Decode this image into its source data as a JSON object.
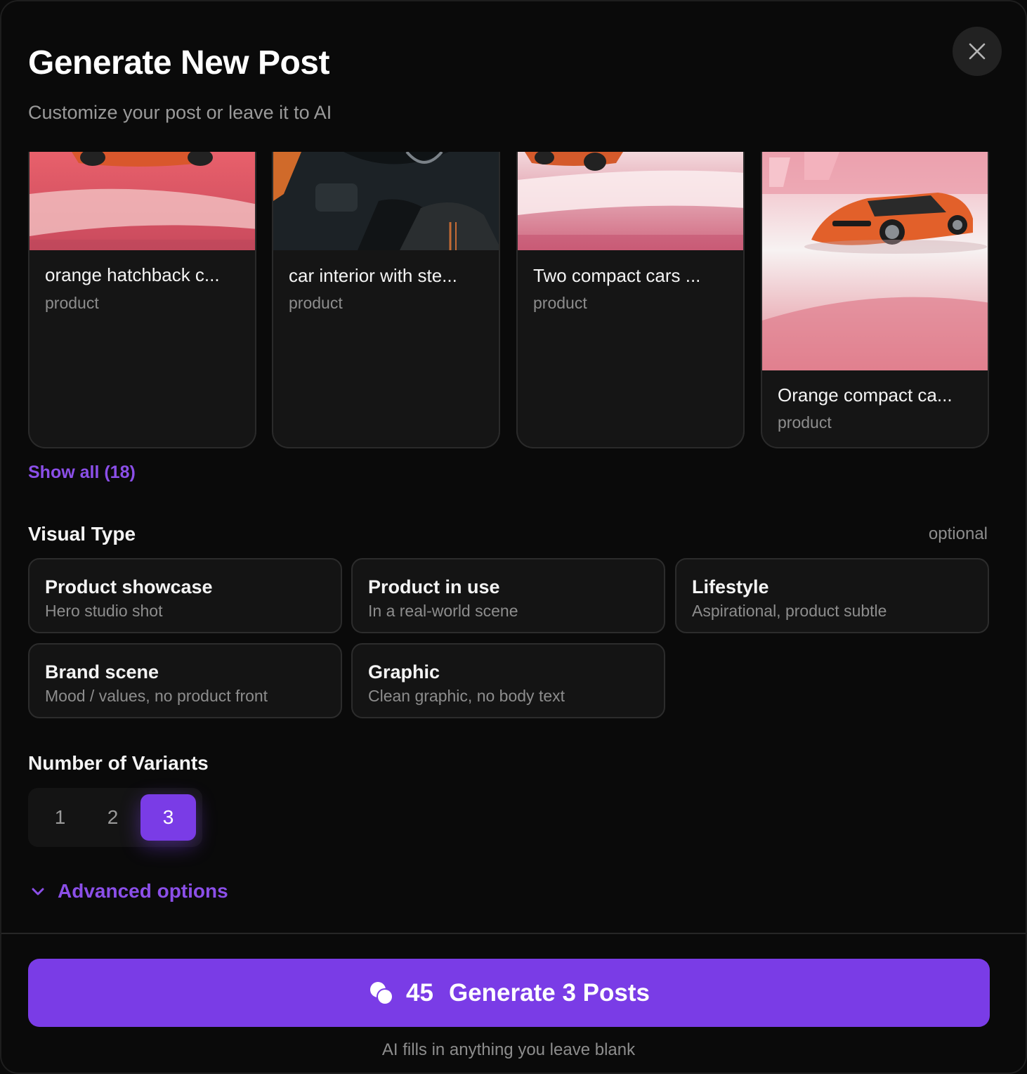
{
  "dialog": {
    "title": "Generate New Post",
    "subtitle": "Customize your post or leave it to AI"
  },
  "products": [
    {
      "name": "orange hatchback c...",
      "tag": "product"
    },
    {
      "name": "car interior with ste...",
      "tag": "product"
    },
    {
      "name": "Two compact cars ...",
      "tag": "product"
    },
    {
      "name": "Orange compact ca...",
      "tag": "product"
    }
  ],
  "show_all": "Show all (18)",
  "visual_type": {
    "label": "Visual Type",
    "optional": "optional",
    "options": [
      {
        "title": "Product showcase",
        "desc": "Hero studio shot"
      },
      {
        "title": "Product in use",
        "desc": "In a real-world scene"
      },
      {
        "title": "Lifestyle",
        "desc": "Aspirational, product subtle"
      },
      {
        "title": "Brand scene",
        "desc": "Mood / values, no product front"
      },
      {
        "title": "Graphic",
        "desc": "Clean graphic, no body text"
      }
    ]
  },
  "variants": {
    "label": "Number of Variants",
    "options": [
      "1",
      "2",
      "3"
    ],
    "selected": "3"
  },
  "advanced": {
    "label": "Advanced options",
    "icon": "chevron-down-icon"
  },
  "generate": {
    "credits": "45",
    "label": "Generate 3 Posts",
    "icon": "coins-icon",
    "footnote": "AI fills in anything you leave blank"
  },
  "colors": {
    "accent": "#7a3ce6",
    "accent_text": "#8b4fe8",
    "background": "#0a0a0a",
    "card": "#151515"
  }
}
